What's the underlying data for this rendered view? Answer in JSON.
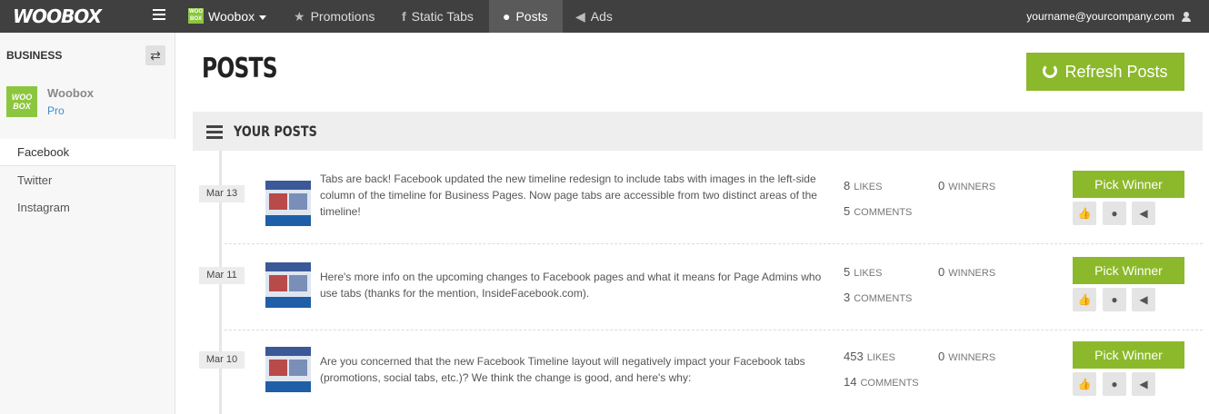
{
  "nav": {
    "logo": "WOOBOX",
    "brand_badge": "WOO BOX",
    "brand": "Woobox",
    "items": [
      {
        "label": "Promotions",
        "icon": "star-icon"
      },
      {
        "label": "Static Tabs",
        "icon": "facebook-icon"
      },
      {
        "label": "Posts",
        "icon": "comment-icon"
      },
      {
        "label": "Ads",
        "icon": "megaphone-icon"
      }
    ],
    "user_email": "yourname@yourcompany.com"
  },
  "sidebar": {
    "heading": "BUSINESS",
    "logo_text": "WOO BOX",
    "account_name": "Woobox",
    "account_plan": "Pro",
    "items": [
      {
        "label": "Facebook"
      },
      {
        "label": "Twitter"
      },
      {
        "label": "Instagram"
      }
    ]
  },
  "main": {
    "title": "POSTS",
    "refresh_label": "Refresh Posts",
    "section_title": "YOUR POSTS",
    "posts": [
      {
        "date": "Mar 13",
        "text": "Tabs are back! Facebook updated the new timeline redesign to include tabs with images in the left-side column of the timeline for Business Pages. Now page tabs are accessible from two distinct areas of the timeline!",
        "likes": "8",
        "comments": "5",
        "winners": "0"
      },
      {
        "date": "Mar 11",
        "text": "Here's more info on the upcoming changes to Facebook pages and what it means for Page Admins who use tabs (thanks for the mention, InsideFacebook.com).",
        "likes": "5",
        "comments": "3",
        "winners": "0"
      },
      {
        "date": "Mar 10",
        "text": "Are you concerned that the new Facebook Timeline layout will negatively impact your Facebook tabs (promotions, social tabs, etc.)? We think the change is good, and here's why:",
        "likes": "453",
        "comments": "14",
        "winners": "0"
      }
    ],
    "labels": {
      "likes": "LIKES",
      "comments": "COMMENTS",
      "winners": "WINNERS",
      "pick_winner": "Pick Winner"
    }
  },
  "colors": {
    "accent_green": "#8cb82b",
    "topbar": "#404040"
  }
}
